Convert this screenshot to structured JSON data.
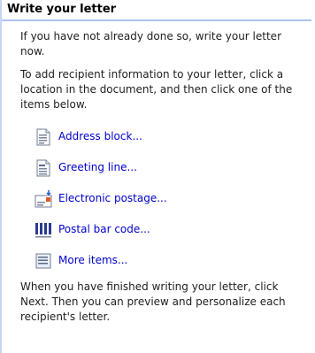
{
  "pane": {
    "title": "Write your letter",
    "intro": "If you have not already done so, write your letter now.",
    "instructions": "To add recipient information to your letter, click a location in the document, and then click one of the items below.",
    "items": [
      {
        "label": "Address block...",
        "icon": "address-block-icon"
      },
      {
        "label": "Greeting line...",
        "icon": "greeting-line-icon"
      },
      {
        "label": "Electronic postage...",
        "icon": "electronic-postage-icon"
      },
      {
        "label": "Postal bar code...",
        "icon": "postal-bar-code-icon"
      },
      {
        "label": "More items...",
        "icon": "more-items-icon"
      }
    ],
    "footer": "When you have finished writing your letter, click Next. Then you can preview and personalize each recipient's letter."
  },
  "colors": {
    "header_border": "#a9c4ef",
    "link": "#0000cc",
    "pane_border": "#c5d5f2"
  }
}
